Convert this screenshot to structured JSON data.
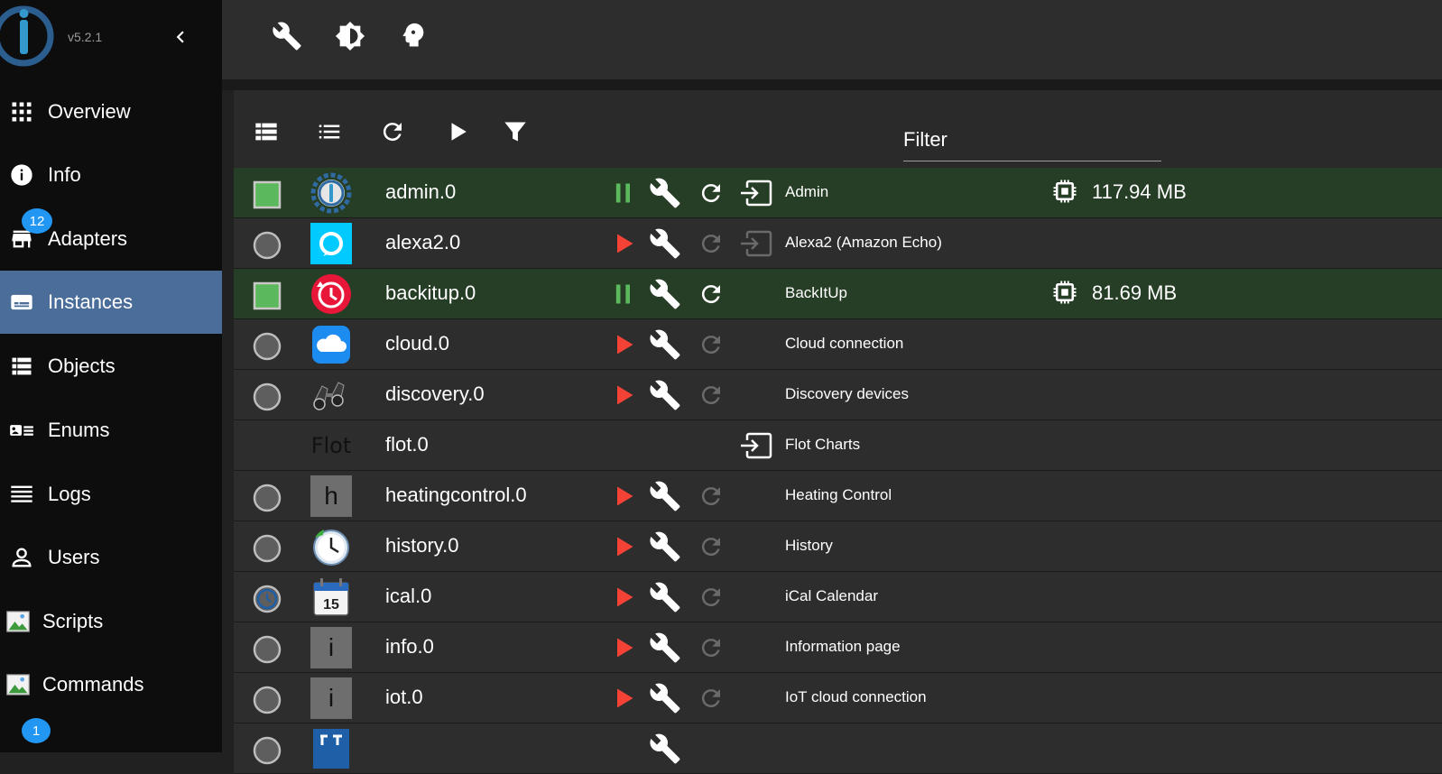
{
  "app": {
    "version": "v5.2.1"
  },
  "sidebar": {
    "items": [
      {
        "label": "Overview",
        "icon": "grid-icon"
      },
      {
        "label": "Info",
        "icon": "info-icon"
      },
      {
        "label": "Adapters",
        "icon": "store-icon",
        "badge": "12"
      },
      {
        "label": "Instances",
        "icon": "instances-icon",
        "active": true
      },
      {
        "label": "Objects",
        "icon": "list-icon"
      },
      {
        "label": "Enums",
        "icon": "enums-icon"
      },
      {
        "label": "Logs",
        "icon": "logs-icon"
      },
      {
        "label": "Users",
        "icon": "user-icon"
      },
      {
        "label": "Scripts",
        "icon": "broken-image-icon"
      },
      {
        "label": "Commands",
        "icon": "broken-image-icon"
      }
    ],
    "bottom_badge": "1"
  },
  "topbar": {
    "buttons": [
      "wrench-icon",
      "brightness-icon",
      "expert-mode-icon"
    ]
  },
  "toolbar": {
    "buttons": [
      "view-compact-icon",
      "view-list-icon",
      "refresh-icon",
      "play-icon",
      "filter-icon"
    ],
    "filter_label": "Filter"
  },
  "instances": [
    {
      "name": "admin.0",
      "title": "Admin",
      "status": "running",
      "memory": "117.94 MB",
      "link": true
    },
    {
      "name": "alexa2.0",
      "title": "Alexa2 (Amazon Echo)",
      "status": "stopped",
      "link": true
    },
    {
      "name": "backitup.0",
      "title": "BackItUp",
      "status": "running",
      "memory": "81.69 MB"
    },
    {
      "name": "cloud.0",
      "title": "Cloud connection",
      "status": "stopped"
    },
    {
      "name": "discovery.0",
      "title": "Discovery devices",
      "status": "stopped"
    },
    {
      "name": "flot.0",
      "title": "Flot Charts",
      "status": "none",
      "link": true,
      "icon_text": "Flot"
    },
    {
      "name": "heatingcontrol.0",
      "title": "Heating Control",
      "status": "stopped",
      "icon_text": "h"
    },
    {
      "name": "history.0",
      "title": "History",
      "status": "stopped"
    },
    {
      "name": "ical.0",
      "title": "iCal Calendar",
      "status": "scheduled"
    },
    {
      "name": "info.0",
      "title": "Information page",
      "status": "stopped",
      "icon_text": "i"
    },
    {
      "name": "iot.0",
      "title": "IoT cloud connection",
      "status": "stopped",
      "icon_text": "i"
    }
  ],
  "colors": {
    "accent": "#4a6d9a",
    "running_row": "#263d26",
    "running_indicator": "#5cb85c",
    "play": "#f44336",
    "badge": "#2196f3"
  }
}
